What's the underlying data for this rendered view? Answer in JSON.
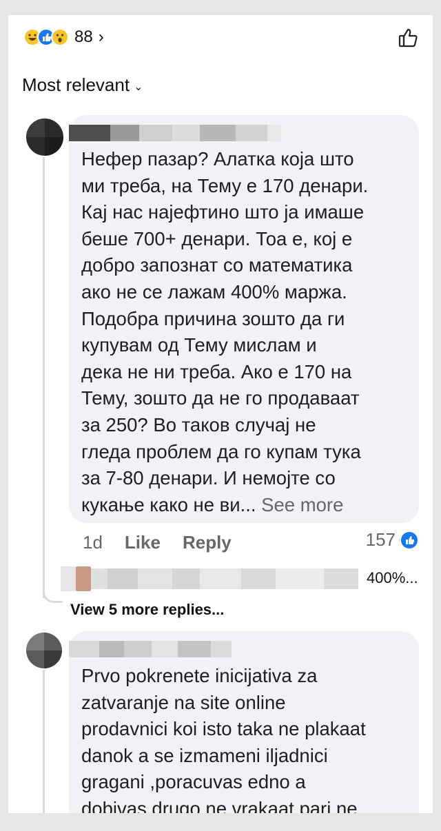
{
  "reactions": {
    "count": "88",
    "icons": [
      "laugh-emoji-icon",
      "like-emoji-icon",
      "wow-emoji-icon"
    ]
  },
  "sort": {
    "label": "Most relevant"
  },
  "comment1": {
    "text": "Нефер пазар? Алатка која што\nми треба, на Тему е 170 денари.\nКај нас најефтино што ја имаше\nбеше 700+ денари. Тоа е, кој е\nдобро запознат со математика\nако не се лажам 400% маржа.\nПодобра причина зошто да ги\nкупувам од Тему мислам и\nдека не ни треба. Ако е 170 на\nТему, зошто да не го продаваат\nза 250? Во таков случај не\nгледа проблем да го купам тука\nза 7-80 денари. И немојте со\nкукање како не ви...",
    "see_more": " See more",
    "time": "1d",
    "like": "Like",
    "reply": "Reply",
    "reaction_count": "157"
  },
  "reply_preview": {
    "text": "400%..."
  },
  "view_more": {
    "label": "View 5 more replies..."
  },
  "comment2": {
    "text": "Prvo pokrenete inicijativa za\nzatvaranje na site online\nprodavnici koi isto taka ne plakaat\ndanok a se izmameni iljadnici\ngragani ,poracuvas edno a\ndobivas drugo ne vrakaat pari ne"
  },
  "colors": {
    "accent": "#1877f2",
    "bubble": "#f0f2f5",
    "muted": "#65676b"
  }
}
